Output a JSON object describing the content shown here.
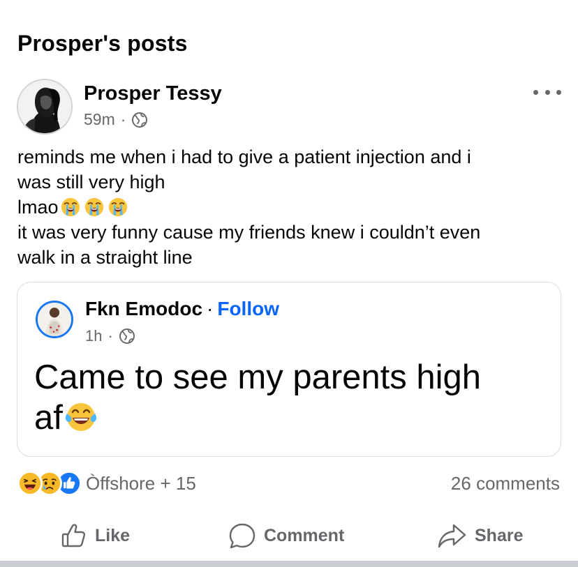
{
  "page": {
    "title": "Prosper's posts"
  },
  "post": {
    "author": "Prosper Tessy",
    "time": "59m",
    "separator": "·",
    "privacy_icon": "globe-icon",
    "more_icon": "more-options-icon",
    "text_lines": [
      "reminds me when i had to give a patient injection and i",
      "was still very high",
      "lmao",
      "it was very funny cause my friends knew i couldn’t even",
      "walk in a straight line"
    ],
    "line_emojis": [
      "loudly-crying-face",
      "loudly-crying-face",
      "loudly-crying-face"
    ]
  },
  "shared": {
    "author": "Fkn Emodoc",
    "separator": "·",
    "follow_label": "Follow",
    "time": "1h",
    "text_line1": "Came to see my parents high",
    "text_line2": "af",
    "emoji": "face-with-tears-of-joy"
  },
  "reactions": {
    "icons": [
      "haha-icon",
      "sad-icon",
      "like-icon"
    ],
    "names": "Òffshore + 15",
    "comments": "26 comments"
  },
  "actions": {
    "like": "Like",
    "comment": "Comment",
    "share": "Share"
  },
  "colors": {
    "accent": "#0866ff",
    "secondary_text": "#65676b",
    "ring": "#1877f2"
  }
}
